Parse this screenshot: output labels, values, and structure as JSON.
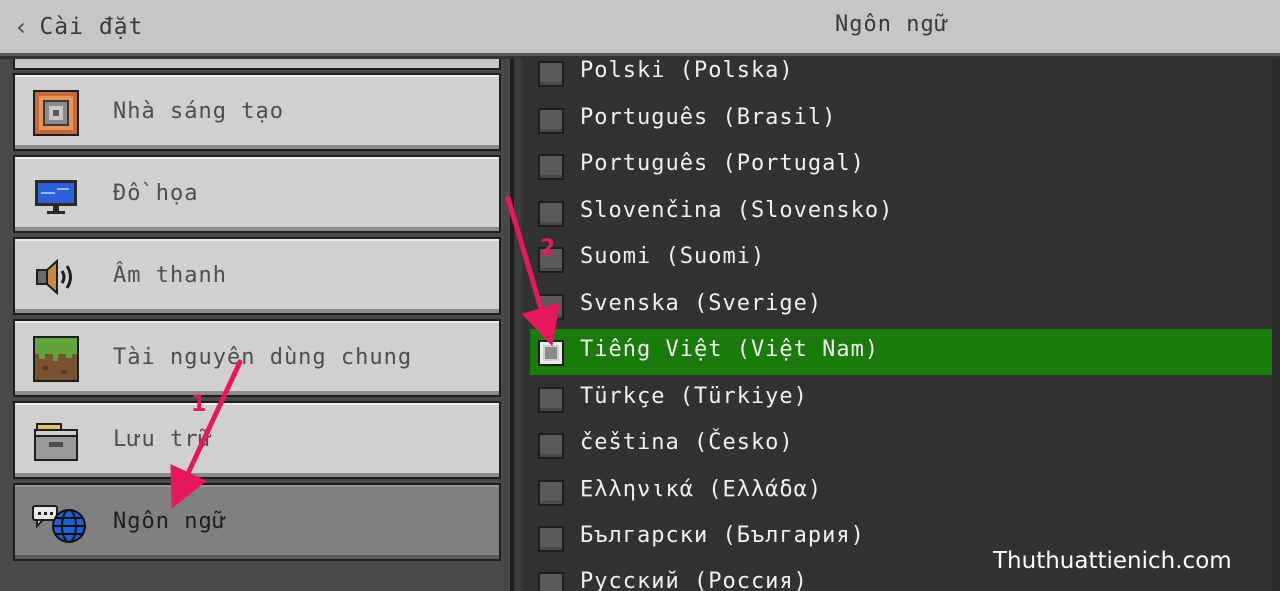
{
  "header": {
    "back_label": "Cài đặt",
    "title": "Ngôn ngữ"
  },
  "sidebar": {
    "items": [
      {
        "label": "Nhà sáng tạo",
        "icon": "command-block-icon"
      },
      {
        "label": "Đồ họa",
        "icon": "monitor-icon"
      },
      {
        "label": "Âm thanh",
        "icon": "speaker-icon"
      },
      {
        "label": "Tài nguyên dùng chung",
        "icon": "grass-block-icon"
      },
      {
        "label": "Lưu trữ",
        "icon": "storage-box-icon"
      },
      {
        "label": "Ngôn ngữ",
        "icon": "language-globe-icon",
        "active": true
      }
    ]
  },
  "languages": [
    {
      "label": "Polski (Polska)"
    },
    {
      "label": "Português (Brasil)"
    },
    {
      "label": "Português (Portugal)"
    },
    {
      "label": "Slovenčina (Slovensko)"
    },
    {
      "label": "Suomi (Suomi)"
    },
    {
      "label": "Svenska (Sverige)"
    },
    {
      "label": "Tiếng Việt (Việt Nam)",
      "selected": true
    },
    {
      "label": "Türkçe (Türkiye)"
    },
    {
      "label": "čeština (Česko)"
    },
    {
      "label": "Ελληνικά (Ελλάδα)"
    },
    {
      "label": "Български (България)"
    },
    {
      "label": "Русский (Россия)"
    }
  ],
  "annotations": {
    "step1": "1",
    "step2": "2",
    "color": "#e8185f"
  },
  "watermark": "Thuthuattienich.com",
  "colors": {
    "selected_row": "#1a7a0c",
    "header_bg": "#c6c6c6",
    "panel_bg": "#313233"
  }
}
